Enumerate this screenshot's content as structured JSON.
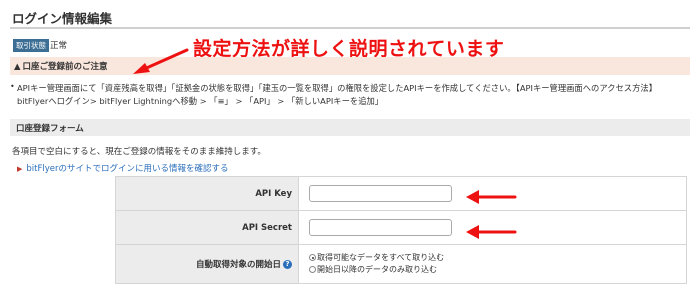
{
  "page": {
    "title": "ログイン情報編集"
  },
  "status": {
    "badge": "取引状態",
    "value": "正常"
  },
  "annotation": {
    "text": "設定方法が詳しく説明されています",
    "color": "#ee1111"
  },
  "caution": {
    "icon": "warning-icon",
    "title": "口座ご登録前のご注意",
    "text": "APIキー管理画面にて「資産残高を取得」「証拠金の状態を取得」「建玉の一覧を取得」の権限を設定したAPIキーを作成してください。【APIキー管理画面へのアクセス方法】bitFlyerへログイン> bitFlyer Lightningへ移動 > 「≡」 > 「API」 > 「新しいAPIキーを追加」",
    "bg_color": "#f9e6dc"
  },
  "form": {
    "section_title": "口座登録フォーム",
    "description": "各項目で空白にすると、現在ご登録の情報をそのまま維持します。",
    "link_text": "bitFlyerのサイトでログインに用いる情報を確認する",
    "api_key": {
      "label": "API Key",
      "value": ""
    },
    "api_secret": {
      "label": "API Secret",
      "value": ""
    },
    "start_date": {
      "label": "自動取得対象の開始日",
      "options": [
        {
          "label": "取得可能なデータをすべて取り込む",
          "selected": true
        },
        {
          "label": "開始日以降のデータのみ取り込む",
          "selected": false
        }
      ]
    }
  },
  "colors": {
    "link": "#2a6ebb",
    "badge_bg": "#3d6f94",
    "arrow": "#ee1111"
  }
}
